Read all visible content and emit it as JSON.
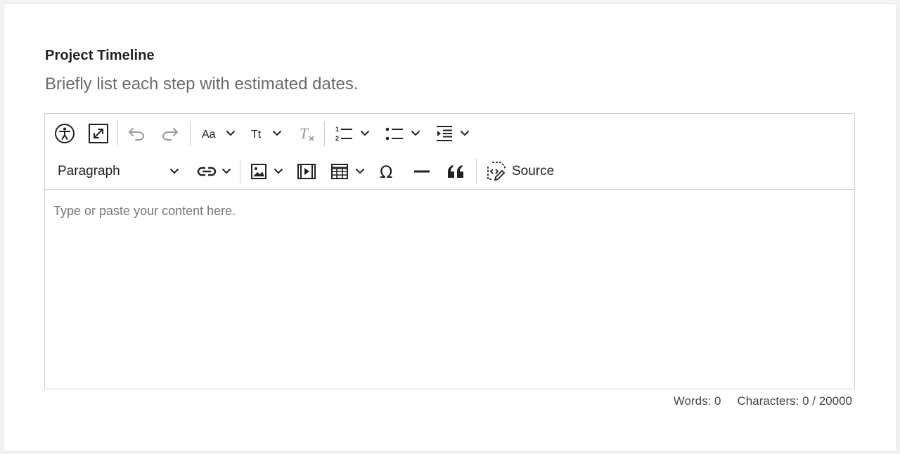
{
  "field": {
    "title": "Project Timeline",
    "hint": "Briefly list each step with estimated dates."
  },
  "toolbar": {
    "row1": [
      {
        "name": "accessibility-help",
        "icon": "accessibility-icon"
      },
      {
        "name": "fullscreen",
        "icon": "maximize-icon"
      },
      {
        "name": "undo",
        "icon": "undo-icon",
        "disabled": true
      },
      {
        "name": "redo",
        "icon": "redo-icon",
        "disabled": true
      },
      {
        "name": "font-family",
        "icon": "font-family-icon",
        "dropdown": true
      },
      {
        "name": "font-size",
        "icon": "font-size-icon",
        "dropdown": true
      },
      {
        "name": "remove-format",
        "icon": "remove-format-icon",
        "disabled": true
      },
      {
        "name": "numbered-list",
        "icon": "numbered-list-icon",
        "dropdown": true
      },
      {
        "name": "bulleted-list",
        "icon": "bulleted-list-icon",
        "dropdown": true
      },
      {
        "name": "indent",
        "icon": "indent-icon",
        "dropdown": true
      }
    ],
    "heading_dropdown_value": "Paragraph",
    "row2": [
      {
        "name": "link",
        "icon": "link-icon",
        "dropdown": true
      },
      {
        "name": "image",
        "icon": "image-icon",
        "dropdown": true
      },
      {
        "name": "media",
        "icon": "media-icon"
      },
      {
        "name": "table",
        "icon": "table-icon",
        "dropdown": true
      },
      {
        "name": "special-characters",
        "icon": "omega-icon"
      },
      {
        "name": "horizontal-line",
        "icon": "horizontal-line-icon"
      },
      {
        "name": "block-quote",
        "icon": "quote-icon"
      }
    ],
    "source_label": "Source"
  },
  "editor": {
    "placeholder": "Type or paste your content here."
  },
  "footer": {
    "words": "Words: 0",
    "characters": "Characters: 0 / 20000"
  },
  "colors": {
    "text": "#222222",
    "hint": "#6a6a6a",
    "disabled_icon": "#9a9a9a",
    "border": "#cfcfcf"
  }
}
